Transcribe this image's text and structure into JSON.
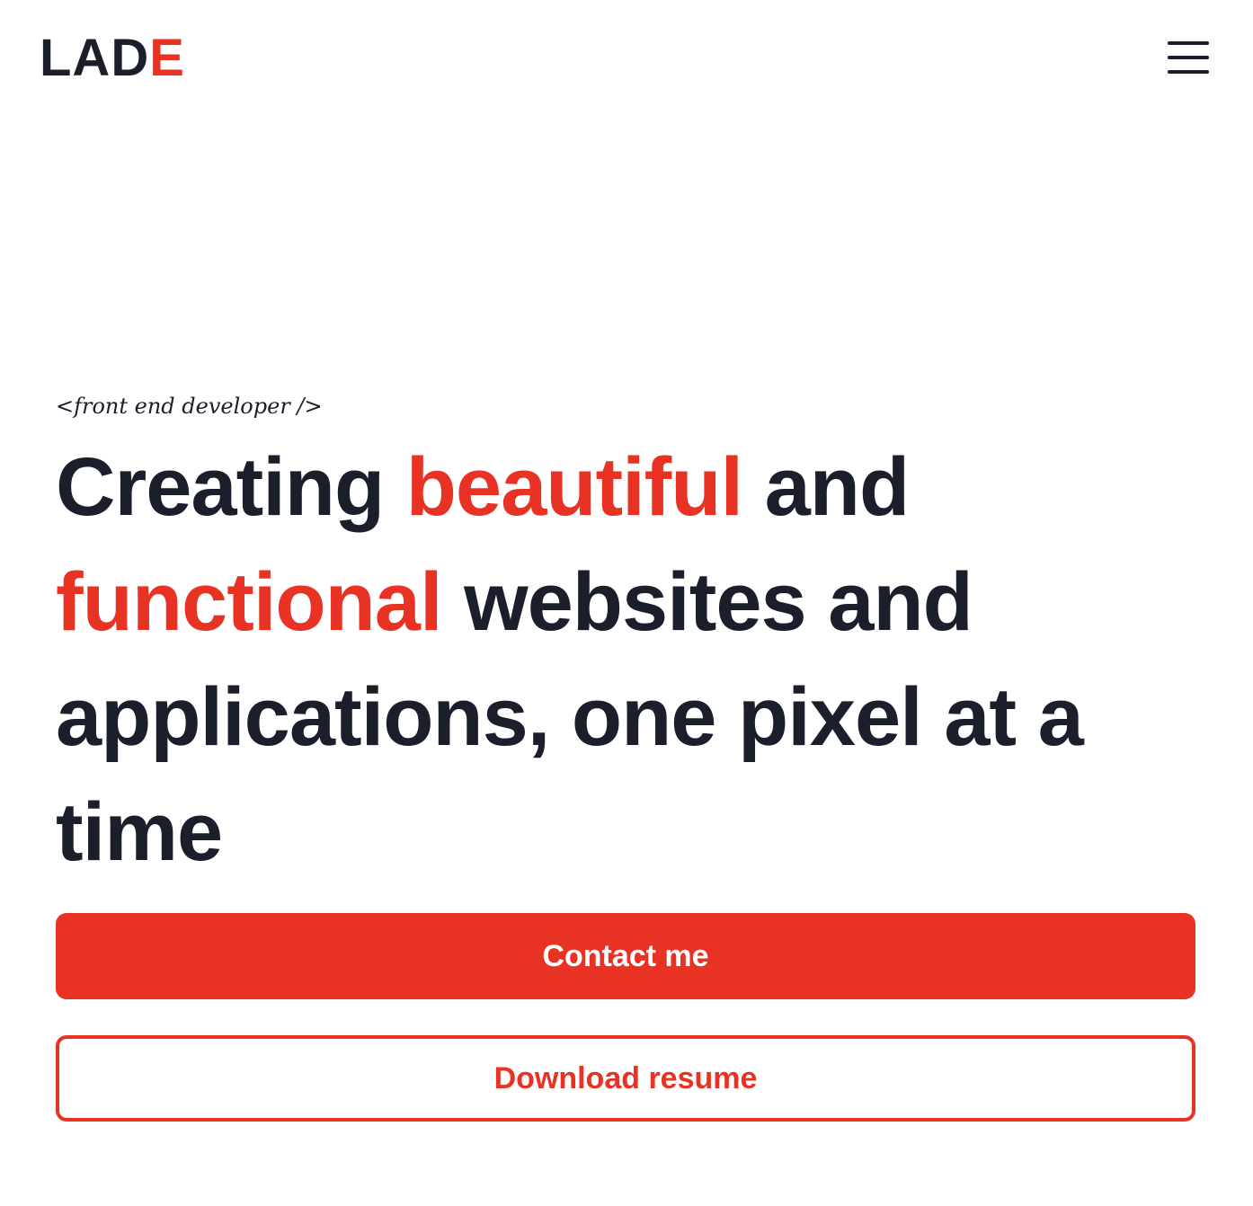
{
  "header": {
    "logo_main": "LAD",
    "logo_accent": "E",
    "menu_icon": "hamburger-menu-icon"
  },
  "hero": {
    "tagline": "<front end developer />",
    "headline": {
      "part1": "Creating ",
      "highlight1": "beautiful",
      "part2": " and ",
      "highlight2": "functional",
      "part3": " websites and applications, one pixel at a time"
    }
  },
  "actions": {
    "contact_label": "Contact me",
    "resume_label": "Download resume"
  },
  "colors": {
    "accent": "#e83224",
    "text": "#1b1f2b",
    "background": "#ffffff"
  }
}
